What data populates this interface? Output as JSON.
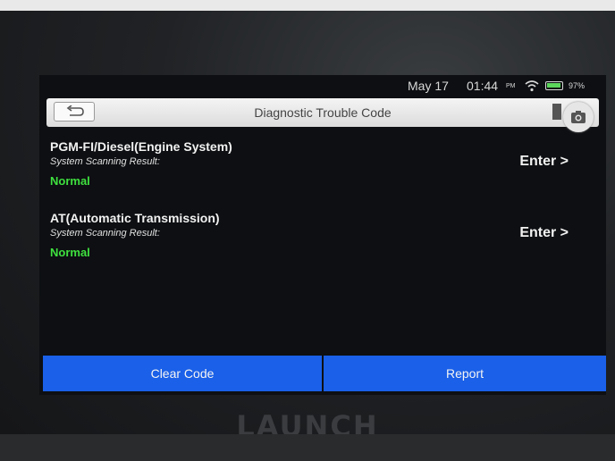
{
  "device": {
    "brand": "LAUNCH"
  },
  "statusbar": {
    "date": "May 17",
    "time": "01:44",
    "ampm": "PM",
    "battery_percent": "97%",
    "battery_level": 0.97,
    "wifi_icon": "wifi-icon",
    "battery_icon": "battery-icon"
  },
  "header": {
    "title": "Diagnostic Trouble Code",
    "back_icon": "back-arrow-icon",
    "report_icon": "document-icon",
    "camera_icon": "camera-icon"
  },
  "systems": [
    {
      "name": "PGM-FI/Diesel(Engine System)",
      "result_label": "System Scanning Result:",
      "status": "Normal",
      "action": "Enter >"
    },
    {
      "name": "AT(Automatic Transmission)",
      "result_label": "System Scanning Result:",
      "status": "Normal",
      "action": "Enter >"
    }
  ],
  "actions": {
    "clear_code": "Clear Code",
    "report": "Report"
  },
  "colors": {
    "accent_blue": "#1a60e8",
    "status_normal": "#3fe03f",
    "header_bg": "#e6e6e6"
  }
}
